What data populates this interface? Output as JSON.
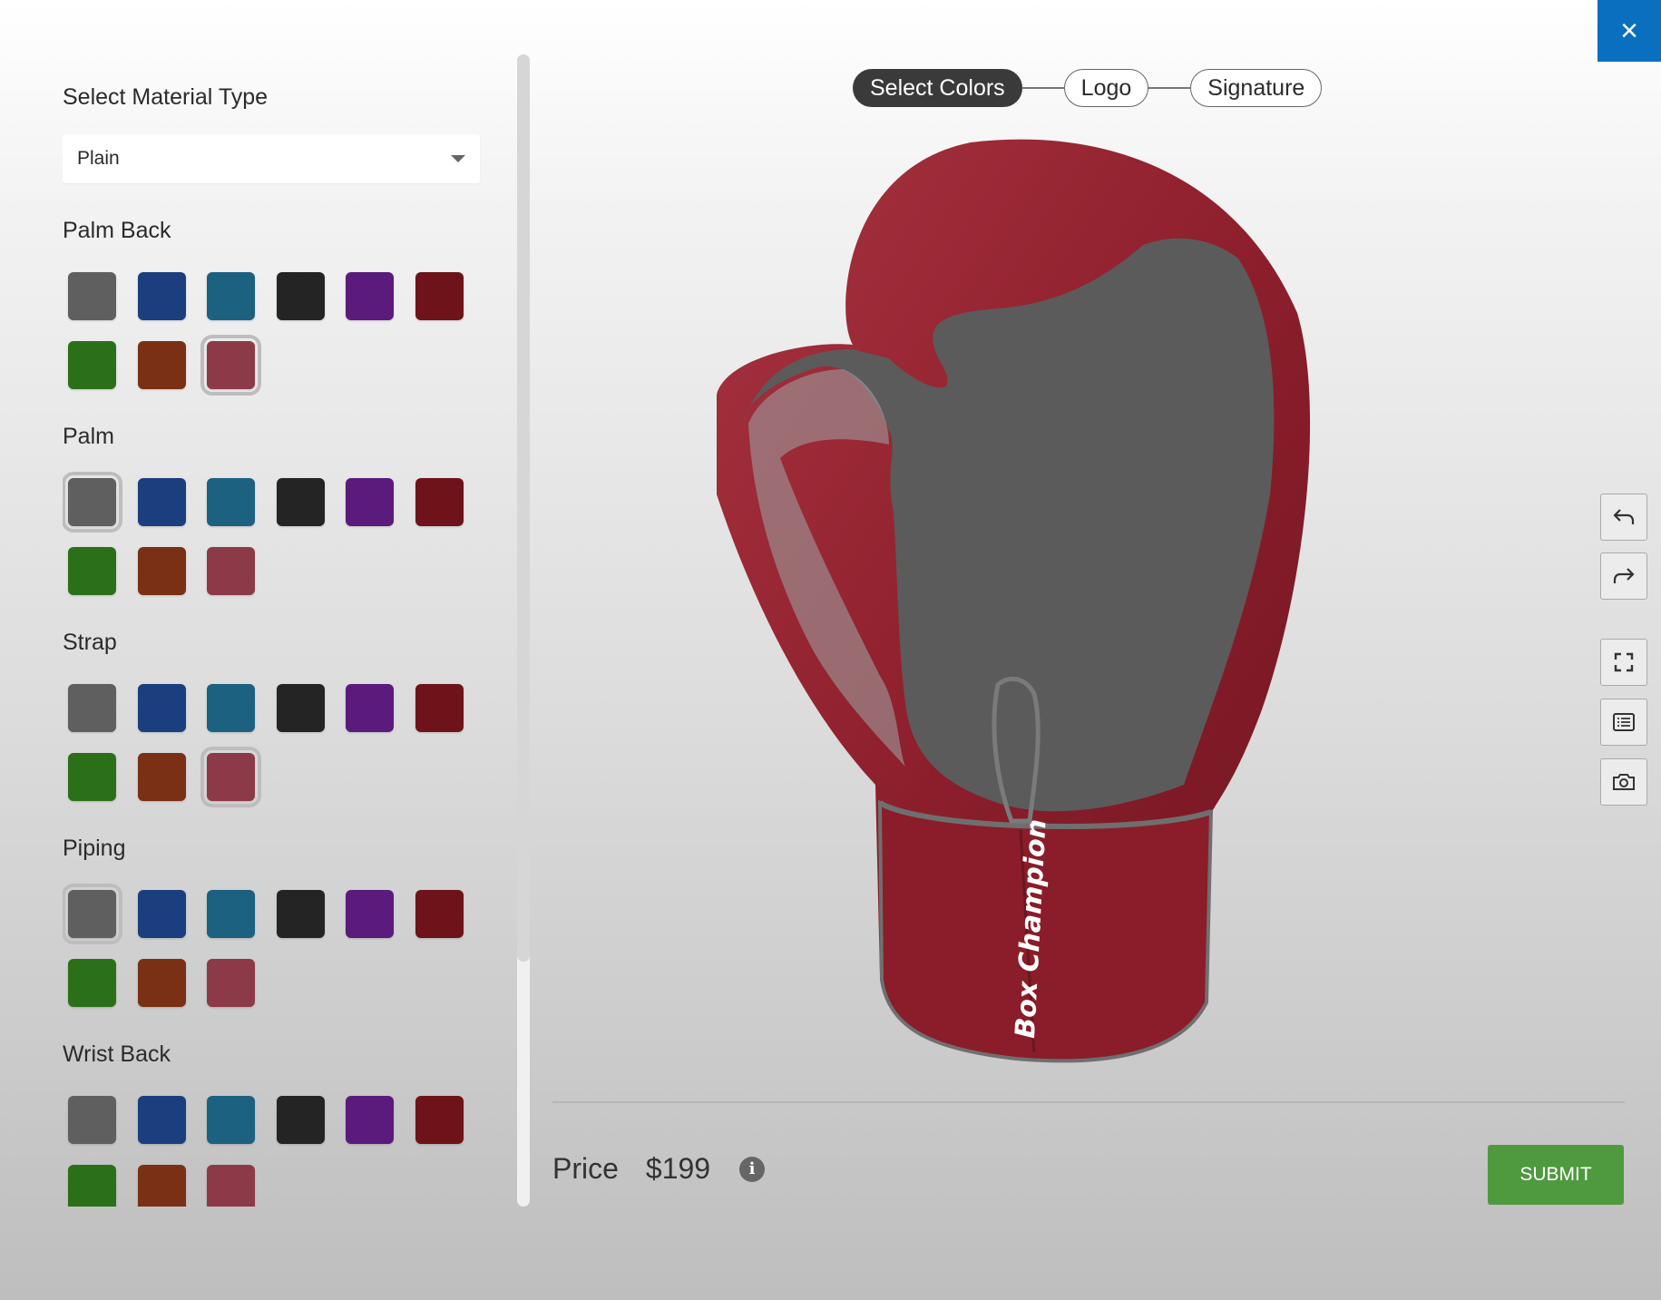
{
  "colors": {
    "gray": "#5f5f5f",
    "navy": "#1b3f7e",
    "teal": "#1d6181",
    "black": "#242424",
    "purple": "#5a1b7d",
    "maroon": "#6d1319",
    "green": "#2b7019",
    "brown": "#7a3014",
    "rose": "#8d3a48"
  },
  "material": {
    "label": "Select Material Type",
    "selected": "Plain"
  },
  "sections": [
    {
      "title": "Palm Back",
      "selected": 8
    },
    {
      "title": "Palm",
      "selected": 0
    },
    {
      "title": "Strap",
      "selected": 8
    },
    {
      "title": "Piping",
      "selected": 0
    },
    {
      "title": "Wrist Back",
      "selected": -1
    }
  ],
  "swatch_names": [
    "gray",
    "navy",
    "teal",
    "black",
    "purple",
    "maroon",
    "green",
    "brown",
    "rose"
  ],
  "steps": [
    {
      "label": "Select Colors",
      "active": true
    },
    {
      "label": "Logo",
      "active": false
    },
    {
      "label": "Signature",
      "active": false
    }
  ],
  "glove": {
    "brand_text": "Box Champion",
    "outer_color": "#8e1f2c",
    "palm_color": "#5f5f5f"
  },
  "tools": [
    "undo-icon",
    "redo-icon",
    "fullscreen-icon",
    "list-icon",
    "camera-icon"
  ],
  "price": {
    "label": "Price",
    "value": "$199"
  },
  "submit_label": "SUBMIT",
  "close_label": "×"
}
